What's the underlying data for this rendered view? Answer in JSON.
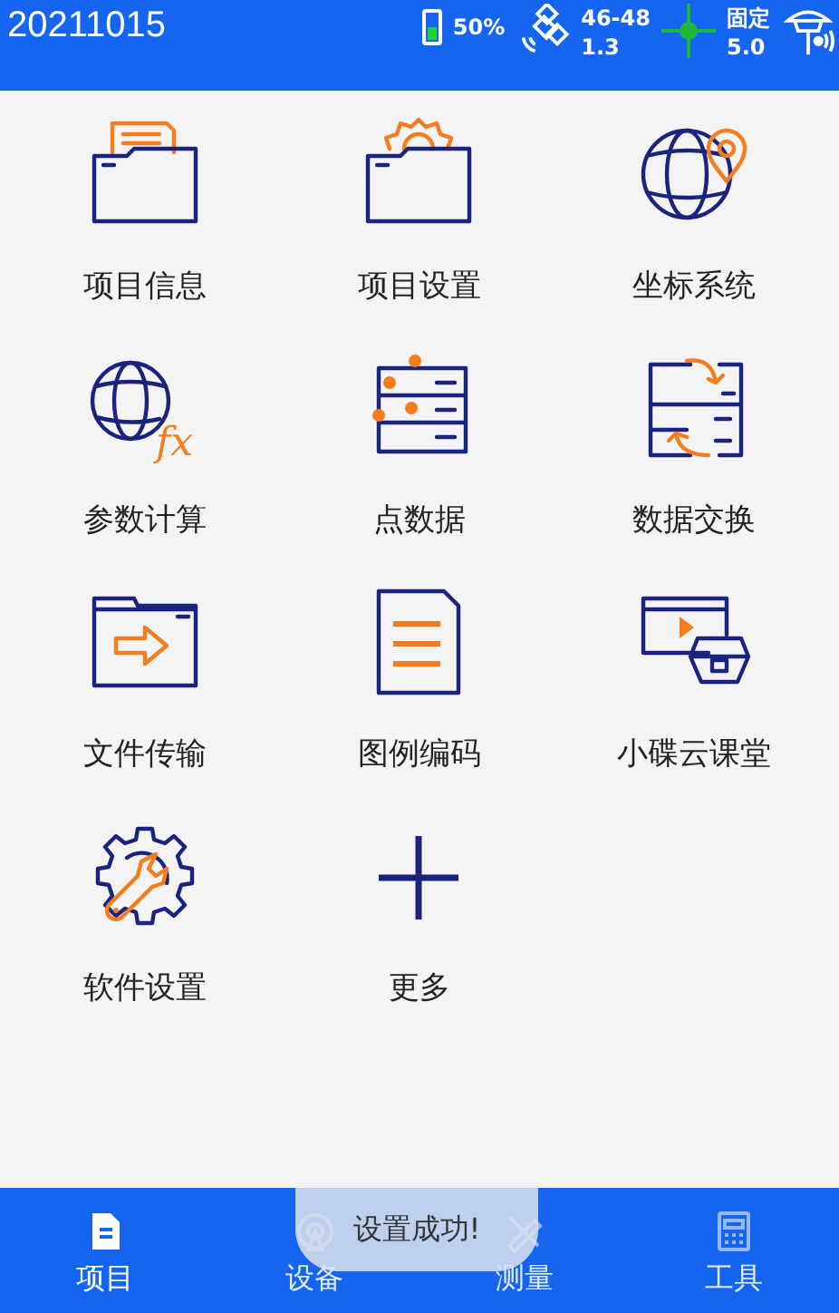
{
  "status_bar": {
    "title": "20211015",
    "battery": {
      "reading": "50%"
    },
    "satellites": {
      "count": "46-48",
      "value": "1.3"
    },
    "solution": {
      "state": "固定",
      "value": "5.0"
    }
  },
  "menu": [
    {
      "label": "项目信息"
    },
    {
      "label": "项目设置"
    },
    {
      "label": "坐标系统"
    },
    {
      "label": "参数计算",
      "icon_text": "fx"
    },
    {
      "label": "点数据"
    },
    {
      "label": "数据交换"
    },
    {
      "label": "文件传输"
    },
    {
      "label": "图例编码"
    },
    {
      "label": "小碟云课堂"
    },
    {
      "label": "软件设置"
    },
    {
      "label": "更多"
    }
  ],
  "tabs": [
    {
      "label": "项目",
      "selected": true
    },
    {
      "label": "设备",
      "selected": false
    },
    {
      "label": "测量",
      "selected": false
    },
    {
      "label": "工具",
      "selected": false
    }
  ],
  "toast": "设置成功!"
}
